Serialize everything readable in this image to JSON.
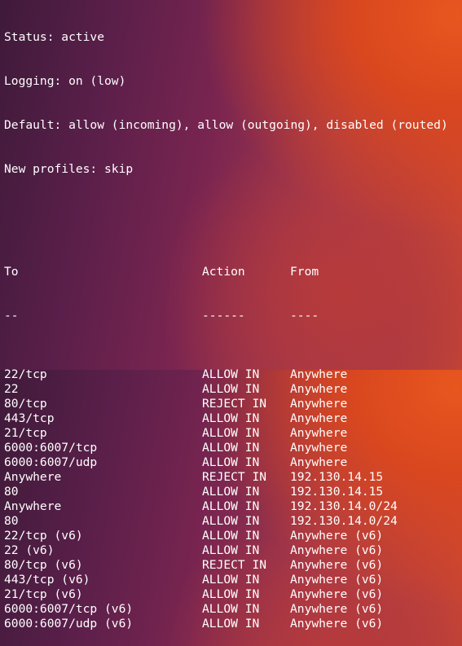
{
  "status": {
    "status_line": "Status: active",
    "logging_line": "Logging: on (low)",
    "default_line": "Default: allow (incoming), allow (outgoing), disabled (routed)",
    "profiles_line": "New profiles: skip"
  },
  "table": {
    "headers": {
      "to": "To",
      "action": "Action",
      "from": "From"
    },
    "separators": {
      "to": "--",
      "action": "------",
      "from": "----"
    },
    "rows": [
      {
        "to": "22/tcp",
        "action": "ALLOW IN",
        "from": "Anywhere"
      },
      {
        "to": "22",
        "action": "ALLOW IN",
        "from": "Anywhere"
      },
      {
        "to": "80/tcp",
        "action": "REJECT IN",
        "from": "Anywhere"
      },
      {
        "to": "443/tcp",
        "action": "ALLOW IN",
        "from": "Anywhere"
      },
      {
        "to": "21/tcp",
        "action": "ALLOW IN",
        "from": "Anywhere"
      },
      {
        "to": "6000:6007/tcp",
        "action": "ALLOW IN",
        "from": "Anywhere"
      },
      {
        "to": "6000:6007/udp",
        "action": "ALLOW IN",
        "from": "Anywhere"
      },
      {
        "to": "Anywhere",
        "action": "REJECT IN",
        "from": "192.130.14.15"
      },
      {
        "to": "80",
        "action": "ALLOW IN",
        "from": "192.130.14.15"
      },
      {
        "to": "Anywhere",
        "action": "ALLOW IN",
        "from": "192.130.14.0/24"
      },
      {
        "to": "80",
        "action": "ALLOW IN",
        "from": "192.130.14.0/24"
      },
      {
        "to": "22/tcp (v6)",
        "action": "ALLOW IN",
        "from": "Anywhere (v6)"
      },
      {
        "to": "22 (v6)",
        "action": "ALLOW IN",
        "from": "Anywhere (v6)"
      },
      {
        "to": "80/tcp (v6)",
        "action": "REJECT IN",
        "from": "Anywhere (v6)"
      },
      {
        "to": "443/tcp (v6)",
        "action": "ALLOW IN",
        "from": "Anywhere (v6)"
      },
      {
        "to": "21/tcp (v6)",
        "action": "ALLOW IN",
        "from": "Anywhere (v6)"
      },
      {
        "to": "6000:6007/tcp (v6)",
        "action": "ALLOW IN",
        "from": "Anywhere (v6)"
      },
      {
        "to": "6000:6007/udp (v6)",
        "action": "ALLOW IN",
        "from": "Anywhere (v6)"
      }
    ]
  }
}
